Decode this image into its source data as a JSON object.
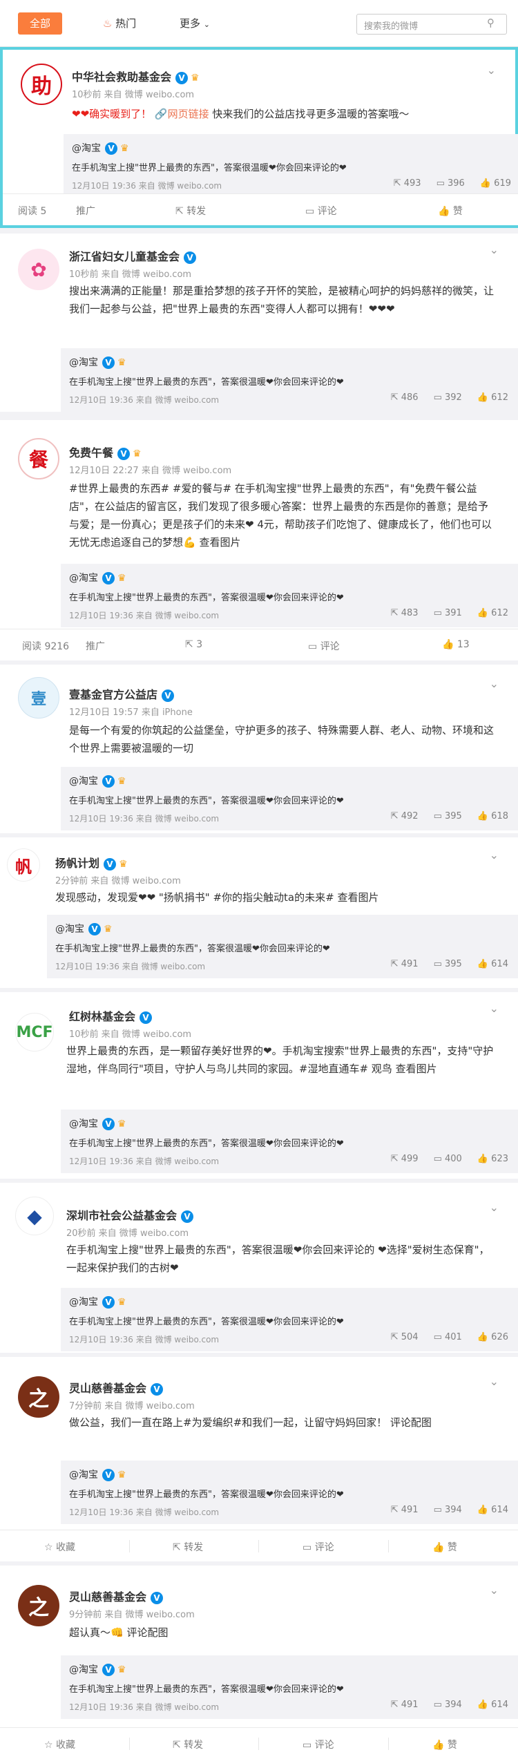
{
  "tabs": {
    "all": "全部",
    "hot": "热门",
    "more": "更多",
    "search_placeholder": "搜索我的微博"
  },
  "colors": {
    "accent": "#fa7d3c",
    "link": "#eb7350",
    "verify": "#0a8ee8",
    "highlight": "#5ad1e0"
  },
  "posts": [
    {
      "name": "中华社会救助基金会",
      "meta": "10秒前 来自 微博 weibo.com",
      "text_a": "❤❤确实暖到了！",
      "link": "网页链接",
      "text_b": "快来我们的公益店找寻更多温暖的答案哦～",
      "repost_user": "@淘宝",
      "repost_text": "在手机淘宝上搜\"世界上最贵的东西\"，答案很温暖❤你会回来评论的❤",
      "repost_meta": "12月10日 19:36 来自 微博 weibo.com",
      "repost_share": "493",
      "repost_comment": "396",
      "repost_like": "619",
      "read": "阅读 5",
      "promote": "推广",
      "forward": "转发",
      "comment": "评论",
      "like": "赞"
    },
    {
      "name": "浙江省妇女儿童基金会",
      "meta": "10秒前 来自 微博 weibo.com",
      "text": "搜出来满满的正能量！那是重拾梦想的孩子开怀的笑脸，是被精心呵护的妈妈慈祥的微笑，让我们一起参与公益，把\"世界上最贵的东西\"变得人人都可以拥有！❤❤❤",
      "repost_user": "@淘宝",
      "repost_text": "在手机淘宝上搜\"世界上最贵的东西\"，答案很温暖❤你会回来评论的❤",
      "repost_meta": "12月10日 19:36 来自 微博 weibo.com",
      "repost_share": "486",
      "repost_comment": "392",
      "repost_like": "612"
    },
    {
      "name": "免费午餐",
      "meta": "12月10日 22:27 来自 微博 weibo.com",
      "text": "#世界上最贵的东西# #爱的餐与# 在手机淘宝搜\"世界上最贵的东西\"，有\"免费午餐公益店\"，在公益店的留言区，我们发现了很多暖心答案：世界上最贵的东西是你的善意；是给予与爱；是一份真心；更是孩子们的未来❤ 4元，帮助孩子们吃饱了、健康成长了，他们也可以无忧无虑追逐自己的梦想💪 查看图片",
      "repost_user": "@淘宝",
      "repost_text": "在手机淘宝上搜\"世界上最贵的东西\"，答案很温暖❤你会回来评论的❤",
      "repost_meta": "12月10日 19:36 来自 微博 weibo.com",
      "repost_share": "483",
      "repost_comment": "391",
      "repost_like": "612",
      "read": "阅读 9216",
      "promote": "推广",
      "forward": "3",
      "comment": "评论",
      "like": "13"
    },
    {
      "name": "壹基金官方公益店",
      "meta": "12月10日 19:57 来自 iPhone",
      "text": "是每一个有爱的你筑起的公益堡垒，守护更多的孩子、特殊需要人群、老人、动物、环境和这个世界上需要被温暖的一切",
      "repost_user": "@淘宝",
      "repost_text": "在手机淘宝上搜\"世界上最贵的东西\"，答案很温暖❤你会回来评论的❤",
      "repost_meta": "12月10日 19:36 来自 微博 weibo.com",
      "repost_share": "492",
      "repost_comment": "395",
      "repost_like": "618"
    },
    {
      "name": "扬帆计划",
      "meta": "2分钟前 来自 微博 weibo.com",
      "text": "发现感动，发现爱❤❤ \"扬帆捐书\" #你的指尖触动ta的未来# 查看图片",
      "repost_user": "@淘宝",
      "repost_text": "在手机淘宝上搜\"世界上最贵的东西\"，答案很温暖❤你会回来评论的❤",
      "repost_meta": "12月10日 19:36 来自 微博 weibo.com",
      "repost_share": "491",
      "repost_comment": "395",
      "repost_like": "614"
    },
    {
      "name": "红树林基金会",
      "meta": "10秒前 来自 微博 weibo.com",
      "text": "世界上最贵的东西，是一颗留存美好世界的❤。手机淘宝搜索\"世界上最贵的东西\"，支持\"守护湿地，伴鸟同行\"项目，守护人与鸟儿共同的家园。#湿地直通车# 观鸟 查看图片",
      "repost_user": "@淘宝",
      "repost_text": "在手机淘宝上搜\"世界上最贵的东西\"，答案很温暖❤你会回来评论的❤",
      "repost_meta": "12月10日 19:36 来自 微博 weibo.com",
      "repost_share": "499",
      "repost_comment": "400",
      "repost_like": "623"
    },
    {
      "name": "深圳市社会公益基金会",
      "meta": "20秒前 来自 微博 weibo.com",
      "text": "在手机淘宝上搜\"世界上最贵的东西\"，答案很温暖❤你会回来评论的 ❤选择\"爱树生态保育\"，一起来保护我们的古树❤",
      "repost_user": "@淘宝",
      "repost_text": "在手机淘宝上搜\"世界上最贵的东西\"，答案很温暖❤你会回来评论的❤",
      "repost_meta": "12月10日 19:36 来自 微博 weibo.com",
      "repost_share": "504",
      "repost_comment": "401",
      "repost_like": "626"
    },
    {
      "name": "灵山慈善基金会",
      "meta": "7分钟前 来自 微博 weibo.com",
      "text": "做公益，我们一直在路上#为爱编织#和我们一起，让留守妈妈回家！ 评论配图",
      "repost_user": "@淘宝",
      "repost_text": "在手机淘宝上搜\"世界上最贵的东西\"，答案很温暖❤你会回来评论的❤",
      "repost_meta": "12月10日 19:36 来自 微博 weibo.com",
      "repost_share": "491",
      "repost_comment": "394",
      "repost_like": "614",
      "fav": "收藏",
      "forward": "转发",
      "comment": "评论",
      "like": "赞"
    },
    {
      "name": "灵山慈善基金会",
      "meta": "9分钟前 来自 微博 weibo.com",
      "text": "超认真～👊 评论配图",
      "repost_user": "@淘宝",
      "repost_text": "在手机淘宝上搜\"世界上最贵的东西\"，答案很温暖❤你会回来评论的❤",
      "repost_meta": "12月10日 19:36 来自 微博 weibo.com",
      "repost_share": "491",
      "repost_comment": "394",
      "repost_like": "614",
      "fav": "收藏",
      "forward": "转发",
      "comment": "评论",
      "like": "赞"
    }
  ]
}
